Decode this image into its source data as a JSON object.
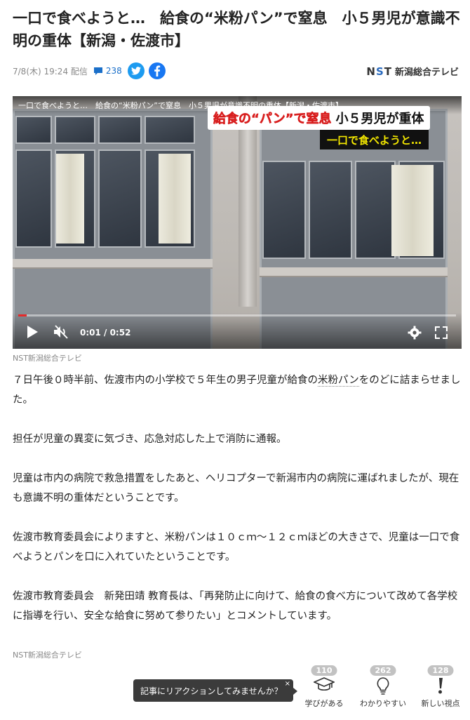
{
  "article": {
    "title": "一口で食べようと…　給食の“米粉パン”で窒息　小５男児が意識不明の重体【新潟・佐渡市】",
    "date": "7/8(木) 19:24 配信",
    "comment_count": "238",
    "publisher": "新潟総合テレビ",
    "publisher_logo": "NST",
    "credit": "NST新潟総合テレビ",
    "paragraphs": [
      [
        "７日午後０時半前、佐渡市内の小学校で５年生の男子児童が給食の",
        "米粉パン",
        "をのどに詰まらせました。"
      ],
      [
        "担任が児童の異変に気づき、応急対応した上で消防に通報。"
      ],
      [
        "児童は市内の病院で救急措置をしたあと、ヘリコプターで新潟市内の病院に運ばれましたが、現在も意識不明の重体だということです。"
      ],
      [
        "佐渡市教育委員会によりますと、米粉パンは１０ｃｍ～１２ｃｍほどの大きさで、児童は一口で食べようとパンを口に入れていたということです。"
      ],
      [
        "佐渡市教育委員会　新発田靖 教育長は、「再発防止に向けて、給食の食べ方について改めて各学校に指導を行い、安全な給食に努めて参りたい」とコメントしています。"
      ]
    ],
    "credit_bottom": "NST新潟総合テレビ"
  },
  "video": {
    "title": "一口で食べようと…　給食の“米粉パン”で窒息　小５男児が意識不明の重体【新潟・佐渡市】",
    "caption_red": "給食の“パン”で窒息",
    "caption_black": "小５男児が重体",
    "caption_sub": "一口で食べようと…",
    "time": "0:01 / 0:52",
    "progress": 0.02
  },
  "reactions": {
    "prompt": "記事にリアクションしてみませんか？",
    "close": "×",
    "items": [
      {
        "label": "学びがある",
        "count": "110",
        "icon": "graduation-cap-icon"
      },
      {
        "label": "わかりやすい",
        "count": "262",
        "icon": "lightbulb-icon"
      },
      {
        "label": "新しい視点",
        "count": "128",
        "icon": "exclamation-icon"
      }
    ]
  },
  "colors": {
    "link": "#1a6fc9",
    "twitter": "#1d9bf0",
    "facebook": "#1877f2",
    "progress": "#e52a2a"
  }
}
